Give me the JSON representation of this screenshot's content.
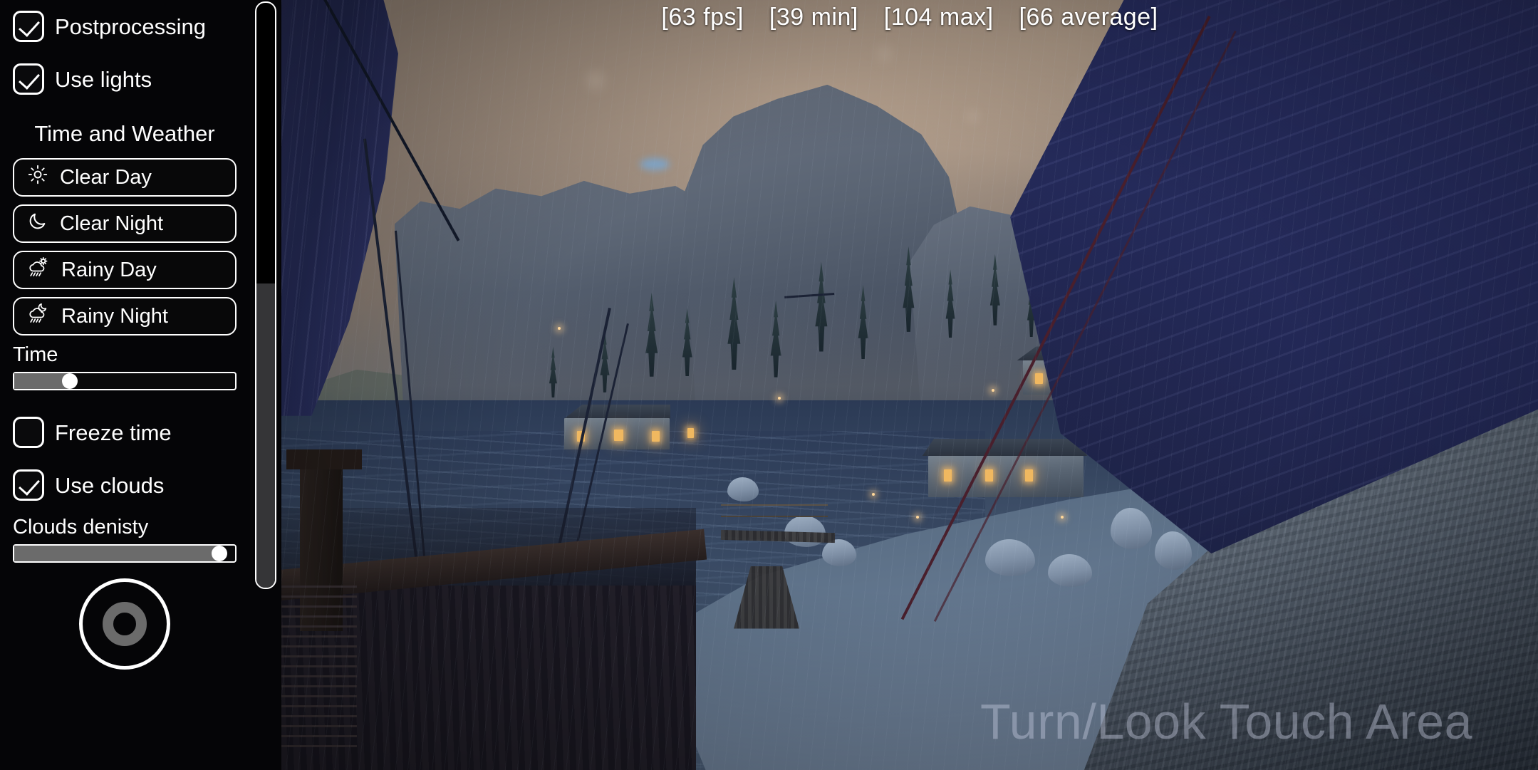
{
  "hud": {
    "fps_stats": [
      "[63 fps]",
      "[39 min]",
      "[104 max]",
      "[66 average]"
    ],
    "touch_area_label": "Turn/Look Touch Area"
  },
  "panel": {
    "checkboxes_top": [
      {
        "label": "Postprocessing",
        "checked": true
      },
      {
        "label": "Use lights",
        "checked": true
      }
    ],
    "section_title": "Time and Weather",
    "weather_buttons": [
      {
        "label": "Clear Day",
        "icon": "sun-icon"
      },
      {
        "label": "Clear Night",
        "icon": "moon-icon"
      },
      {
        "label": "Rainy Day",
        "icon": "cloud-sun-rain-icon"
      },
      {
        "label": "Rainy Night",
        "icon": "cloud-moon-rain-icon"
      }
    ],
    "time_slider": {
      "label": "Time",
      "value": 25
    },
    "freeze_time": {
      "label": "Freeze time",
      "checked": false
    },
    "use_clouds": {
      "label": "Use clouds",
      "checked": true
    },
    "clouds_slider": {
      "label": "Clouds denisty",
      "value": 93
    },
    "joystick": {
      "name": "movement-joystick"
    },
    "scrollbar": {
      "thumb_start_pct": 48
    }
  },
  "colors": {
    "panel_bg": "#050507",
    "accent_white": "#ffffff",
    "slider_fill": "#6b6b6b",
    "sail_blue": "#2a3068",
    "window_glow": "#f0b860",
    "sky_haze": "#9c8b7c"
  }
}
